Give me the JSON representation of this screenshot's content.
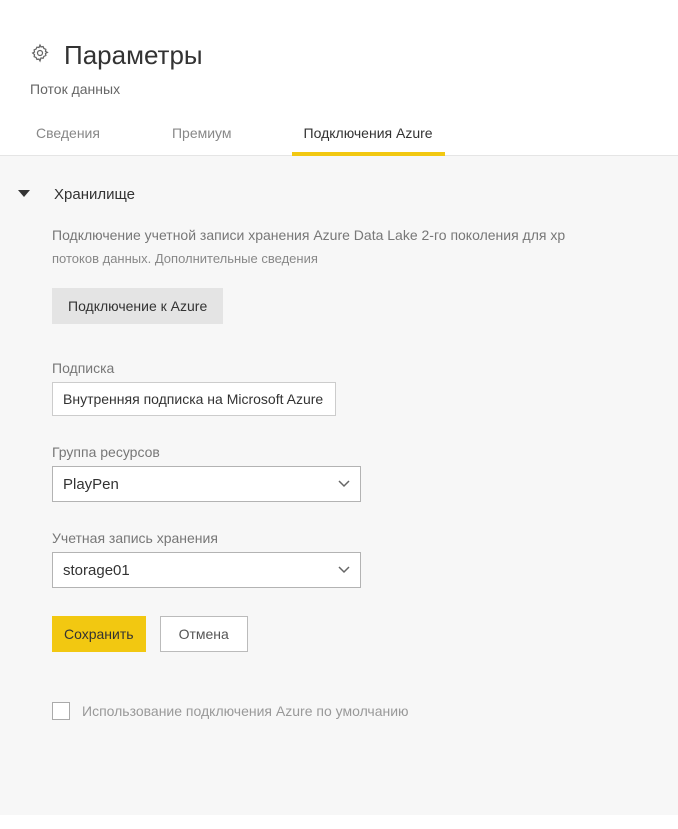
{
  "header": {
    "title": "Параметры",
    "subtitle": "Поток данных"
  },
  "tabs": {
    "items": [
      {
        "label": "Сведения"
      },
      {
        "label": "Премиум"
      },
      {
        "label": "Подключения Azure"
      }
    ]
  },
  "storage_section": {
    "title": "Хранилище",
    "description_line1": "Подключение учетной записи хранения Azure Data Lake 2-го поколения для хр",
    "description_line2": "потоков данных. Дополнительные сведения",
    "connect_button": "Подключение к Azure",
    "subscription_label": "Подписка",
    "subscription_value": "Внутренняя подписка на Microsoft Azure",
    "resource_group_label": "Группа ресурсов",
    "resource_group_value": "PlayPen",
    "storage_account_label": "Учетная запись хранения",
    "storage_account_value": "storage01",
    "save_button": "Сохранить",
    "cancel_button": "Отмена",
    "default_checkbox_label": "Использование подключения Azure по умолчанию"
  }
}
